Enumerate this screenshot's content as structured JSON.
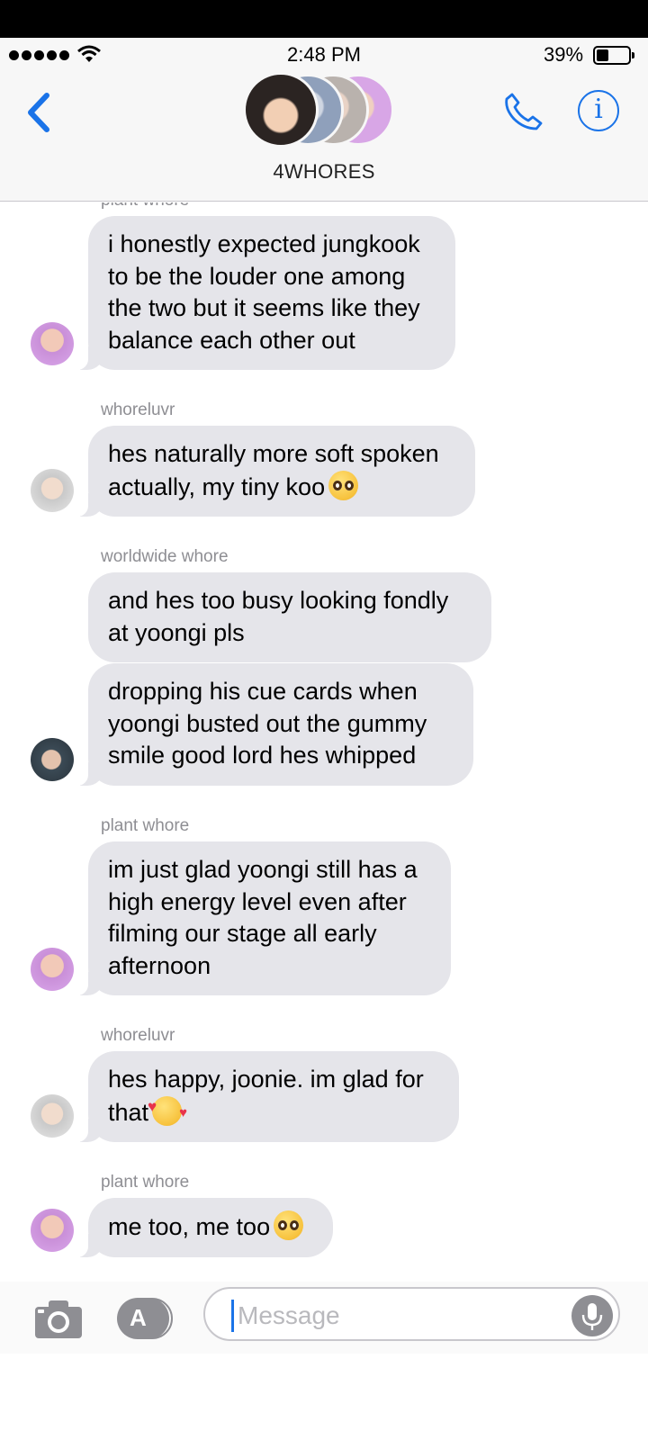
{
  "status_bar": {
    "time": "2:48 PM",
    "battery_percent": "39%",
    "battery_level": 0.39
  },
  "header": {
    "group_name": "4WHORES"
  },
  "messages": [
    {
      "sender": "plant whore",
      "text": "i honestly expected jungkook to be the louder one among the two but it seems like they balance each other out"
    },
    {
      "sender": "whoreluvr",
      "text": "hes naturally more soft spoken actually, my tiny koo",
      "emoji": "pleading-face"
    },
    {
      "sender": "worldwide whore",
      "text": "and hes too busy looking fondly at yoongi pls"
    },
    {
      "text": "dropping his cue cards when yoongi busted out the gummy smile good lord hes whipped"
    },
    {
      "sender": "plant whore",
      "text": "im just glad yoongi still has a high energy level even after filming our stage all early afternoon"
    },
    {
      "sender": "whoreluvr",
      "text": "hes happy, joonie. im glad for that",
      "emoji": "smiling-face-with-hearts"
    },
    {
      "sender": "plant whore",
      "text": "me too, me too",
      "emoji": "pleading-face"
    }
  ],
  "input": {
    "placeholder": "Message"
  }
}
